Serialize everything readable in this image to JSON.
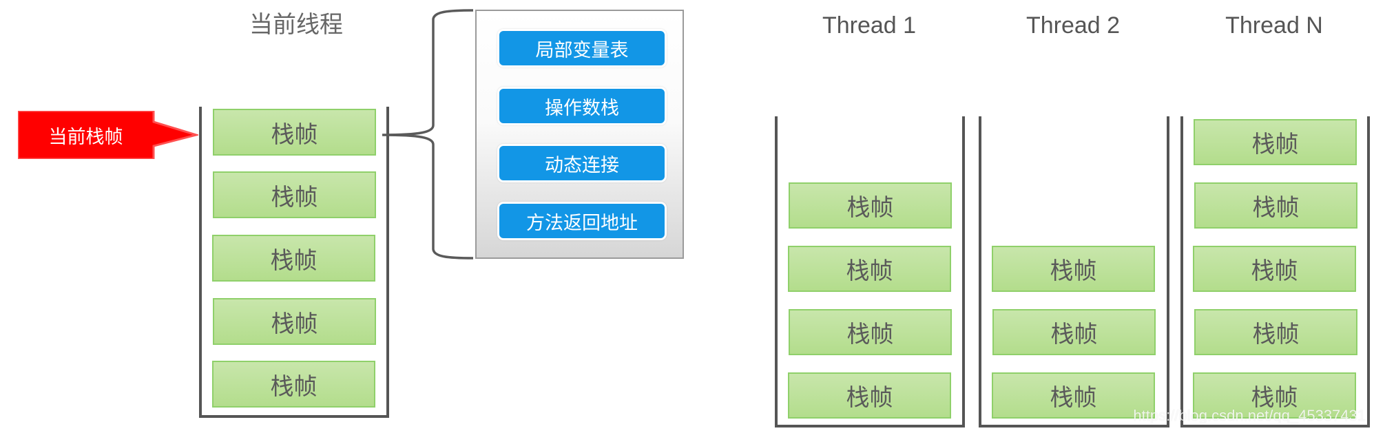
{
  "current_thread": {
    "title": "当前线程",
    "current_frame_label": "当前栈帧",
    "frames": [
      "栈帧",
      "栈帧",
      "栈帧",
      "栈帧",
      "栈帧"
    ]
  },
  "frame_detail": {
    "items": [
      "局部变量表",
      "操作数栈",
      "动态连接",
      "方法返回地址"
    ]
  },
  "threads": [
    {
      "title": "Thread 1",
      "frames": [
        "栈帧",
        "栈帧",
        "栈帧",
        "栈帧"
      ]
    },
    {
      "title": "Thread 2",
      "frames": [
        "栈帧",
        "栈帧",
        "栈帧"
      ]
    },
    {
      "title": "Thread N",
      "frames": [
        "栈帧",
        "栈帧",
        "栈帧",
        "栈帧",
        "栈帧"
      ]
    }
  ],
  "watermark": "https://blog.csdn.net/qq_45337431",
  "colors": {
    "frame_fill": "#b9e095",
    "frame_border": "#8fd06a",
    "detail_button": "#1296e6",
    "current_arrow": "#ff0000",
    "stack_line": "#555555"
  }
}
